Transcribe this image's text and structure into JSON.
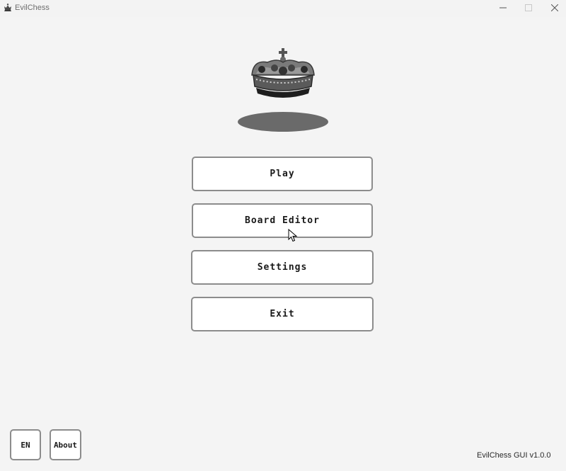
{
  "window": {
    "title": "EvilChess",
    "app_icon": "chess-king-icon",
    "controls": {
      "minimize": "minimize-icon",
      "maximize": "maximize-icon",
      "close": "close-icon"
    }
  },
  "logo": {
    "icon": "crown-icon"
  },
  "menu": {
    "play_label": "Play",
    "board_editor_label": "Board Editor",
    "settings_label": "Settings",
    "exit_label": "Exit"
  },
  "footer": {
    "language_label": "EN",
    "about_label": "About",
    "version": "EvilChess GUI v1.0.0"
  },
  "colors": {
    "background": "#f4f4f4",
    "button_background": "#ffffff",
    "button_border": "#8c8c8c",
    "shadow": "#6a6a6a",
    "text": "#1a1a1a"
  }
}
